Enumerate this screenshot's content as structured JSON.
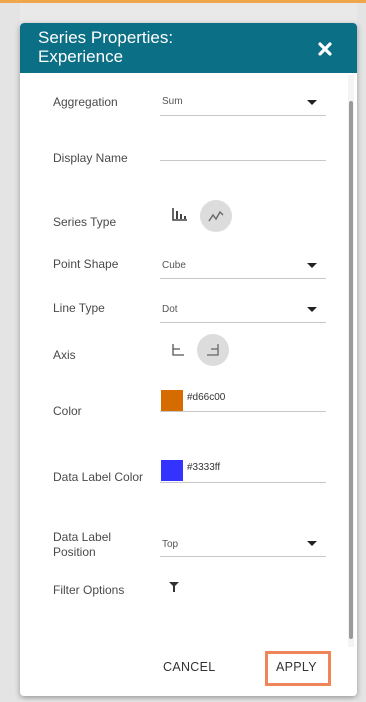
{
  "dialog": {
    "title_line1": "Series Properties:",
    "title_line2": "Experience"
  },
  "fields": {
    "aggregation": {
      "label": "Aggregation",
      "value": "Sum"
    },
    "display_name": {
      "label": "Display Name",
      "value": ""
    },
    "series_type": {
      "label": "Series Type"
    },
    "point_shape": {
      "label": "Point Shape",
      "value": "Cube"
    },
    "line_type": {
      "label": "Line Type",
      "value": "Dot"
    },
    "axis": {
      "label": "Axis"
    },
    "color": {
      "label": "Color",
      "hex": "#d66c00"
    },
    "data_label_color": {
      "label": "Data Label Color",
      "hex": "#3333ff"
    },
    "data_label_position": {
      "label_line1": "Data Label",
      "label_line2": "Position",
      "value": "Top"
    },
    "filter_options": {
      "label": "Filter Options"
    }
  },
  "footer": {
    "cancel_label": "CANCEL",
    "apply_label": "APPLY"
  },
  "colors": {
    "header": "#0b6f86",
    "highlight": "#ef8559"
  },
  "icons": [
    "close-icon",
    "bar-chart-icon",
    "line-chart-icon",
    "axis-left-icon",
    "axis-right-icon",
    "filter-icon",
    "dropdown-caret-icon"
  ]
}
